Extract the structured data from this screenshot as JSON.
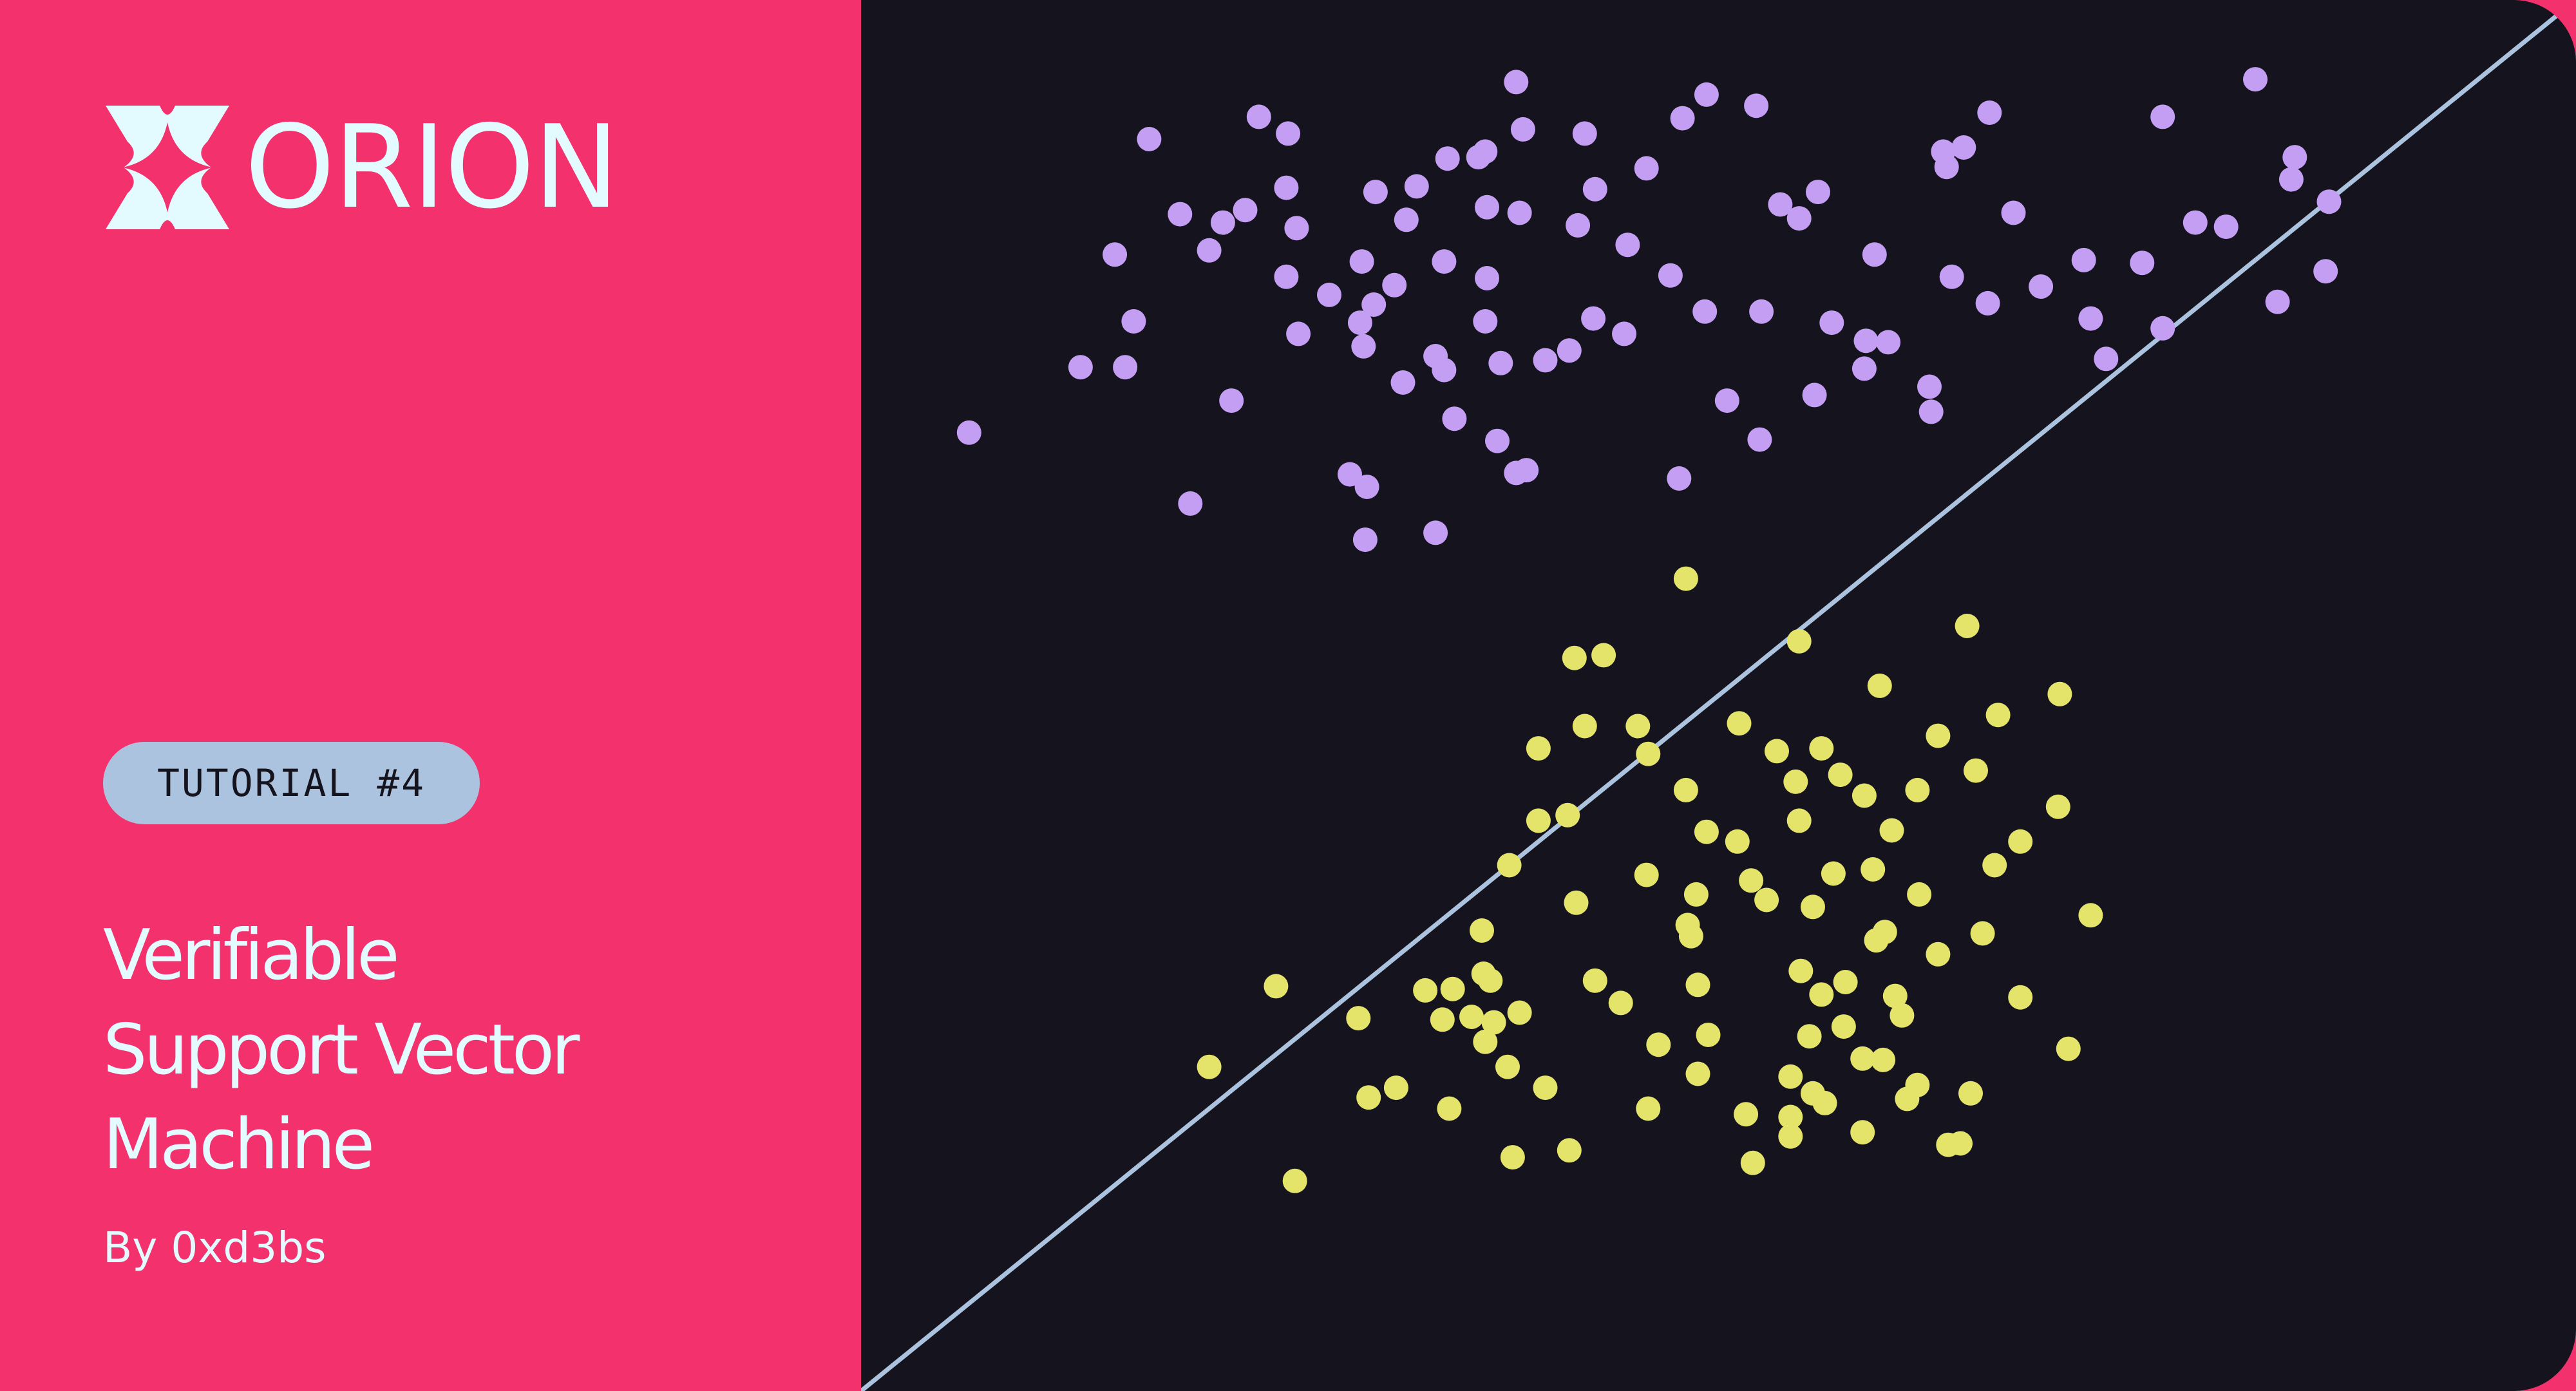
{
  "brand": {
    "name": "ORION",
    "logo_icon": "orion-star-icon",
    "text_color": "#e3fbff"
  },
  "badge": {
    "label": "TUTORIAL #4",
    "background": "#abc3de"
  },
  "title": {
    "lines": [
      "Verifiable",
      "Support Vector",
      "Machine"
    ]
  },
  "author": "By 0xd3bs",
  "colors": {
    "left_panel": "#f3316d",
    "right_panel": "#15141e",
    "class_a": "#c39ef2",
    "class_b": "#e4e36a",
    "boundary": "#abc3de"
  },
  "chart_data": {
    "type": "scatter",
    "x_range": [
      0,
      1
    ],
    "y_range": [
      0,
      1
    ],
    "grid": false,
    "decision_boundary": {
      "type": "line",
      "from": [
        0,
        0
      ],
      "to": [
        1,
        1
      ]
    },
    "series": [
      {
        "points": [
          [
            0.063,
            0.689
          ],
          [
            0.128,
            0.736
          ],
          [
            0.192,
            0.638
          ],
          [
            0.295,
            0.65
          ],
          [
            0.364,
            0.891
          ],
          [
            0.382,
            0.941
          ],
          [
            0.479,
            0.915
          ],
          [
            0.536,
            0.853
          ],
          [
            0.547,
            0.843
          ],
          [
            0.633,
            0.88
          ],
          [
            0.643,
            0.894
          ],
          [
            0.658,
            0.919
          ],
          [
            0.631,
            0.891
          ],
          [
            0.591,
            0.817
          ],
          [
            0.558,
            0.862
          ],
          [
            0.522,
            0.924
          ],
          [
            0.493,
            0.932
          ],
          [
            0.458,
            0.879
          ],
          [
            0.422,
            0.904
          ],
          [
            0.386,
            0.907
          ],
          [
            0.36,
            0.887
          ],
          [
            0.342,
            0.886
          ],
          [
            0.324,
            0.866
          ],
          [
            0.34,
            0.812
          ],
          [
            0.311,
            0.795
          ],
          [
            0.293,
            0.751
          ],
          [
            0.273,
            0.788
          ],
          [
            0.248,
            0.801
          ],
          [
            0.224,
            0.849
          ],
          [
            0.211,
            0.84
          ],
          [
            0.203,
            0.82
          ],
          [
            0.168,
            0.9
          ],
          [
            0.159,
            0.769
          ],
          [
            0.154,
            0.736
          ],
          [
            0.148,
            0.817
          ],
          [
            0.216,
            0.712
          ],
          [
            0.285,
            0.659
          ],
          [
            0.294,
            0.612
          ],
          [
            0.335,
            0.617
          ],
          [
            0.291,
            0.768
          ],
          [
            0.316,
            0.725
          ],
          [
            0.346,
            0.699
          ],
          [
            0.371,
            0.683
          ],
          [
            0.382,
            0.66
          ],
          [
            0.388,
            0.662
          ],
          [
            0.445,
            0.76
          ],
          [
            0.492,
            0.776
          ],
          [
            0.525,
            0.776
          ],
          [
            0.566,
            0.768
          ],
          [
            0.585,
            0.735
          ],
          [
            0.599,
            0.754
          ],
          [
            0.623,
            0.722
          ],
          [
            0.624,
            0.704
          ],
          [
            0.636,
            0.801
          ],
          [
            0.657,
            0.782
          ],
          [
            0.688,
            0.794
          ],
          [
            0.717,
            0.771
          ],
          [
            0.726,
            0.742
          ],
          [
            0.759,
            0.764
          ],
          [
            0.826,
            0.783
          ],
          [
            0.854,
            0.805
          ],
          [
            0.796,
            0.837
          ],
          [
            0.747,
            0.811
          ],
          [
            0.759,
            0.916
          ],
          [
            0.813,
            0.943
          ],
          [
            0.836,
            0.887
          ],
          [
            0.856,
            0.855
          ],
          [
            0.834,
            0.871
          ],
          [
            0.778,
            0.84
          ],
          [
            0.713,
            0.813
          ],
          [
            0.672,
            0.847
          ],
          [
            0.586,
            0.755
          ],
          [
            0.556,
            0.716
          ],
          [
            0.524,
            0.684
          ],
          [
            0.505,
            0.712
          ],
          [
            0.477,
            0.656
          ],
          [
            0.427,
            0.771
          ],
          [
            0.413,
            0.748
          ],
          [
            0.399,
            0.741
          ],
          [
            0.364,
            0.769
          ],
          [
            0.373,
            0.739
          ],
          [
            0.34,
            0.734
          ],
          [
            0.299,
            0.781
          ],
          [
            0.335,
            0.744
          ],
          [
            0.292,
            0.812
          ],
          [
            0.365,
            0.8
          ],
          [
            0.248,
            0.865
          ],
          [
            0.232,
            0.916
          ],
          [
            0.447,
            0.824
          ],
          [
            0.418,
            0.838
          ],
          [
            0.472,
            0.802
          ],
          [
            0.428,
            0.864
          ],
          [
            0.384,
            0.847
          ],
          [
            0.3,
            0.862
          ],
          [
            0.249,
            0.904
          ],
          [
            0.186,
            0.846
          ],
          [
            0.254,
            0.836
          ],
          [
            0.318,
            0.842
          ],
          [
            0.365,
            0.851
          ],
          [
            0.255,
            0.76
          ]
        ]
      },
      {
        "points": [
          [
            0.395,
            0.462
          ],
          [
            0.422,
            0.478
          ],
          [
            0.417,
            0.351
          ],
          [
            0.458,
            0.371
          ],
          [
            0.487,
            0.357
          ],
          [
            0.482,
            0.335
          ],
          [
            0.493,
            0.402
          ],
          [
            0.519,
            0.367
          ],
          [
            0.555,
            0.348
          ],
          [
            0.574,
            0.294
          ],
          [
            0.542,
            0.226
          ],
          [
            0.562,
            0.207
          ],
          [
            0.542,
            0.197
          ],
          [
            0.596,
            0.238
          ],
          [
            0.647,
            0.214
          ],
          [
            0.634,
            0.177
          ],
          [
            0.641,
            0.178
          ],
          [
            0.61,
            0.21
          ],
          [
            0.616,
            0.22
          ],
          [
            0.584,
            0.186
          ],
          [
            0.488,
            0.228
          ],
          [
            0.494,
            0.256
          ],
          [
            0.465,
            0.249
          ],
          [
            0.413,
            0.173
          ],
          [
            0.399,
            0.218
          ],
          [
            0.343,
            0.203
          ],
          [
            0.312,
            0.218
          ],
          [
            0.329,
            0.288
          ],
          [
            0.29,
            0.268
          ],
          [
            0.296,
            0.211
          ],
          [
            0.203,
            0.233
          ],
          [
            0.253,
            0.151
          ],
          [
            0.242,
            0.291
          ],
          [
            0.38,
            0.168
          ],
          [
            0.52,
            0.164
          ],
          [
            0.542,
            0.183
          ],
          [
            0.555,
            0.214
          ],
          [
            0.603,
            0.284
          ],
          [
            0.628,
            0.314
          ],
          [
            0.654,
            0.329
          ],
          [
            0.661,
            0.378
          ],
          [
            0.617,
            0.357
          ],
          [
            0.676,
            0.395
          ],
          [
            0.717,
            0.342
          ],
          [
            0.676,
            0.283
          ],
          [
            0.704,
            0.246
          ],
          [
            0.597,
            0.33
          ],
          [
            0.573,
            0.262
          ],
          [
            0.553,
            0.255
          ],
          [
            0.56,
            0.285
          ],
          [
            0.607,
            0.27
          ],
          [
            0.548,
            0.302
          ],
          [
            0.567,
            0.372
          ],
          [
            0.59,
            0.375
          ],
          [
            0.601,
            0.403
          ],
          [
            0.585,
            0.428
          ],
          [
            0.547,
            0.41
          ],
          [
            0.511,
            0.395
          ],
          [
            0.481,
            0.432
          ],
          [
            0.453,
            0.478
          ],
          [
            0.416,
            0.527
          ],
          [
            0.433,
            0.529
          ],
          [
            0.512,
            0.48
          ],
          [
            0.545,
            0.438
          ],
          [
            0.571,
            0.443
          ],
          [
            0.616,
            0.432
          ],
          [
            0.628,
            0.471
          ],
          [
            0.663,
            0.486
          ],
          [
            0.698,
            0.42
          ],
          [
            0.699,
            0.501
          ],
          [
            0.645,
            0.55
          ],
          [
            0.594,
            0.507
          ],
          [
            0.547,
            0.539
          ],
          [
            0.481,
            0.584
          ],
          [
            0.459,
            0.458
          ],
          [
            0.395,
            0.41
          ],
          [
            0.378,
            0.378
          ],
          [
            0.367,
            0.295
          ],
          [
            0.356,
            0.269
          ],
          [
            0.339,
            0.267
          ],
          [
            0.345,
            0.289
          ],
          [
            0.363,
            0.3
          ],
          [
            0.384,
            0.272
          ],
          [
            0.369,
            0.265
          ],
          [
            0.362,
            0.331
          ],
          [
            0.364,
            0.251
          ],
          [
            0.443,
            0.279
          ],
          [
            0.428,
            0.295
          ],
          [
            0.488,
            0.292
          ],
          [
            0.459,
            0.203
          ],
          [
            0.516,
            0.199
          ],
          [
            0.584,
            0.239
          ],
          [
            0.592,
            0.324
          ],
          [
            0.56,
            0.462
          ],
          [
            0.534,
            0.46
          ],
          [
            0.65,
            0.446
          ],
          [
            0.528,
            0.353
          ],
          [
            0.484,
            0.327
          ],
          [
            0.412,
            0.414
          ],
          [
            0.377,
            0.233
          ]
        ]
      }
    ]
  }
}
